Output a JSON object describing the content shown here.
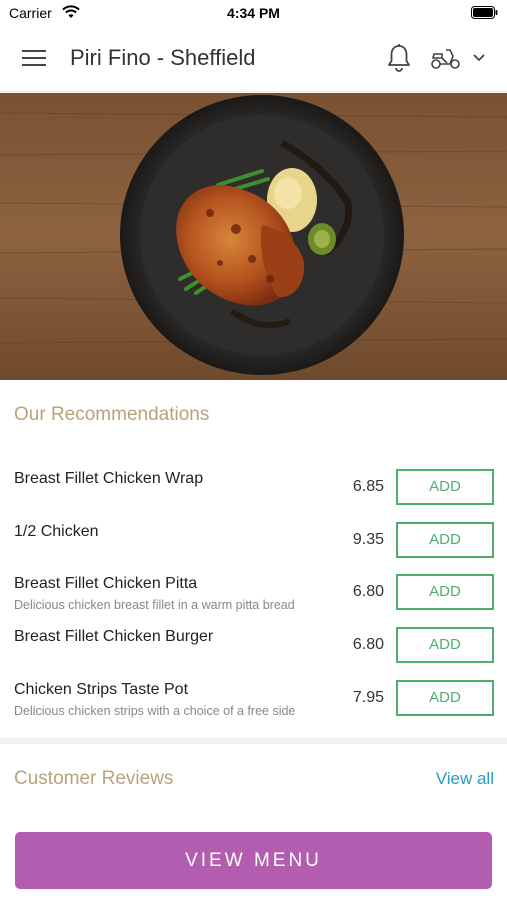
{
  "status_bar": {
    "carrier": "Carrier",
    "time": "4:34 PM"
  },
  "header": {
    "title": "Piri Fino - Sheffield",
    "icons": [
      "hamburger-menu-icon",
      "bell-icon",
      "scooter-icon",
      "chevron-down-icon"
    ]
  },
  "hero": {
    "image": "plate-of-piri-chicken-photo"
  },
  "recommendations": {
    "title": "Our Recommendations",
    "items": [
      {
        "name": "Breast Fillet Chicken Wrap",
        "description": "",
        "price": "6.85",
        "action": "ADD"
      },
      {
        "name": "1/2 Chicken",
        "description": "",
        "price": "9.35",
        "action": "ADD"
      },
      {
        "name": "Breast Fillet Chicken Pitta",
        "description": "Delicious chicken breast fillet in a warm pitta bread",
        "price": "6.80",
        "action": "ADD"
      },
      {
        "name": "Breast Fillet Chicken Burger",
        "description": "",
        "price": "6.80",
        "action": "ADD"
      },
      {
        "name": "Chicken Strips Taste Pot",
        "description": "Delicious chicken strips with a choice of a free side",
        "price": "7.95",
        "action": "ADD"
      }
    ]
  },
  "reviews": {
    "title": "Customer Reviews",
    "view_all": "View all"
  },
  "footer": {
    "view_menu": "VIEW MENU"
  },
  "colors": {
    "accent_gold": "#b9a27c",
    "add_green": "#4fae6f",
    "link_blue": "#2a9bc4",
    "button_purple": "#b35db0"
  }
}
